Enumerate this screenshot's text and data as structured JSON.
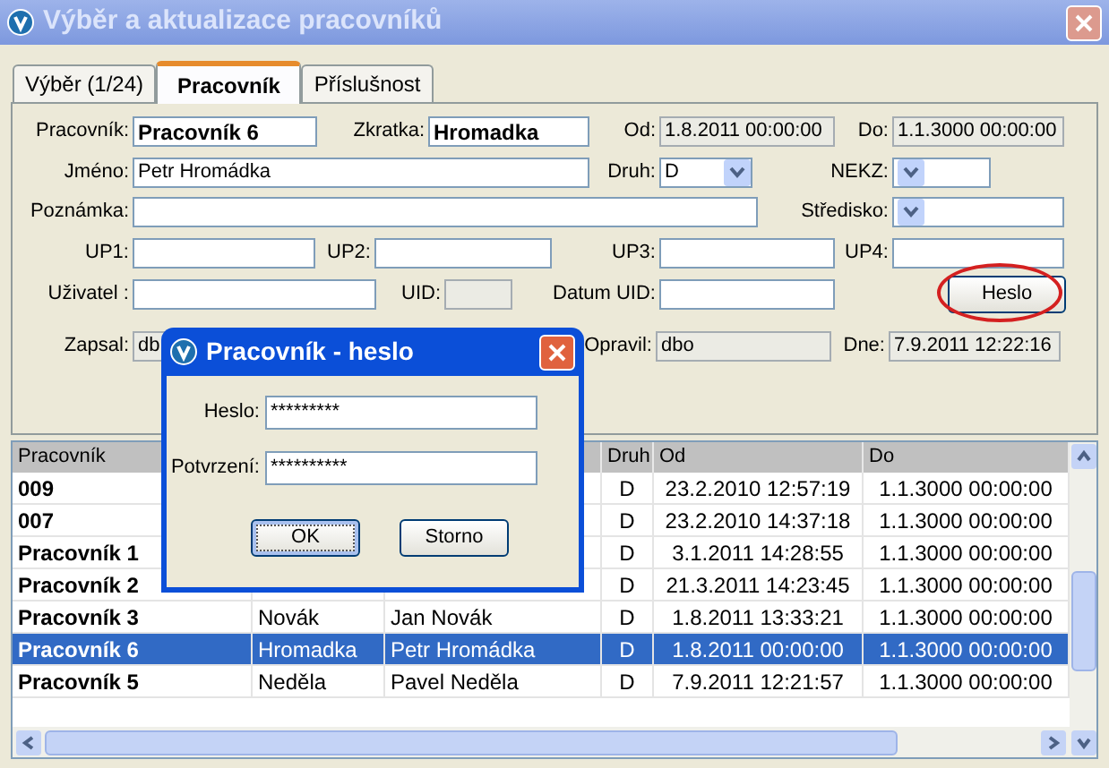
{
  "window": {
    "title": "Výběr a aktualizace pracovníků"
  },
  "tabs": [
    {
      "label": "Výběr (1/24)",
      "selected": false
    },
    {
      "label": "Pracovník",
      "selected": true
    },
    {
      "label": "Příslušnost",
      "selected": false
    }
  ],
  "form": {
    "rows": [
      [
        {
          "label": "Pracovník:",
          "value": "Pracovník 6",
          "kind": "text",
          "bold": true
        },
        {
          "label": "Zkratka:",
          "value": "Hromadka",
          "kind": "text",
          "bold": true
        },
        {
          "label": "Od:",
          "value": "1.8.2011 00:00:00",
          "kind": "readonly"
        },
        {
          "label": "Do:",
          "value": "1.1.3000 00:00:00",
          "kind": "readonly"
        }
      ],
      [
        {
          "label": "Jméno:",
          "value": "Petr Hromádka",
          "kind": "text"
        },
        {
          "label": "Druh:",
          "value": "D",
          "kind": "combo"
        },
        {
          "label": "NEKZ:",
          "kind": "combo"
        }
      ],
      [
        {
          "label": "Poznámka:",
          "kind": "text"
        },
        {
          "label": "Středisko:",
          "kind": "combo"
        }
      ],
      [
        {
          "label": "UP1:",
          "kind": "text"
        },
        {
          "label": "UP2:",
          "kind": "text"
        },
        {
          "label": "UP3:",
          "kind": "text"
        },
        {
          "label": "UP4:",
          "kind": "text"
        }
      ],
      [
        {
          "label": "Uživatel :",
          "kind": "text"
        },
        {
          "label": "UID:",
          "kind": "readonly"
        },
        {
          "label": "Datum UID:",
          "kind": "text"
        },
        {
          "label": "Heslo",
          "kind": "button",
          "circled": true
        }
      ],
      [
        {
          "label": "Zapsal:",
          "value": "db",
          "kind": "readonly"
        },
        {
          "label": "Opravil:",
          "value": "dbo",
          "kind": "readonly"
        },
        {
          "label": "Dne:",
          "value": "7.9.2011 12:22:16",
          "kind": "readonly"
        }
      ]
    ]
  },
  "table": {
    "columns": [
      {
        "label": "Pracovník"
      },
      {},
      {},
      {
        "label": "Druh"
      },
      {
        "label": "Od"
      },
      {
        "label": "Do"
      }
    ],
    "rows": [
      {
        "selected": false,
        "cells": [
          "009",
          null,
          null,
          "D",
          "23.2.2010 12:57:19",
          "1.1.3000 00:00:00"
        ]
      },
      {
        "selected": false,
        "cells": [
          "007",
          null,
          null,
          "D",
          "23.2.2010 14:37:18",
          "1.1.3000 00:00:00"
        ]
      },
      {
        "selected": false,
        "cells": [
          "Pracovník 1",
          null,
          null,
          "D",
          "3.1.2011 14:28:55",
          "1.1.3000 00:00:00"
        ]
      },
      {
        "selected": false,
        "cells": [
          "Pracovník 2",
          null,
          null,
          "D",
          "21.3.2011 14:23:45",
          "1.1.3000 00:00:00"
        ]
      },
      {
        "selected": false,
        "cells": [
          "Pracovník 3",
          "Novák",
          "Jan Novák",
          "D",
          "1.8.2011 13:33:21",
          "1.1.3000 00:00:00"
        ]
      },
      {
        "selected": true,
        "cells": [
          "Pracovník 6",
          "Hromadka",
          "Petr Hromádka",
          "D",
          "1.8.2011 00:00:00",
          "1.1.3000 00:00:00"
        ]
      },
      {
        "selected": false,
        "cells": [
          "Pracovník 5",
          "Neděla",
          "Pavel Neděla",
          "D",
          "7.9.2011 12:21:57",
          "1.1.3000 00:00:00"
        ]
      }
    ]
  },
  "dialog": {
    "title": "Pracovník - heslo",
    "fields": [
      {
        "label": "Heslo:",
        "value": "*********"
      },
      {
        "label": "Potvrzení:",
        "value": "**********"
      }
    ],
    "buttons": [
      {
        "label": "OK",
        "default": true
      },
      {
        "label": "Storno",
        "default": false
      }
    ]
  }
}
